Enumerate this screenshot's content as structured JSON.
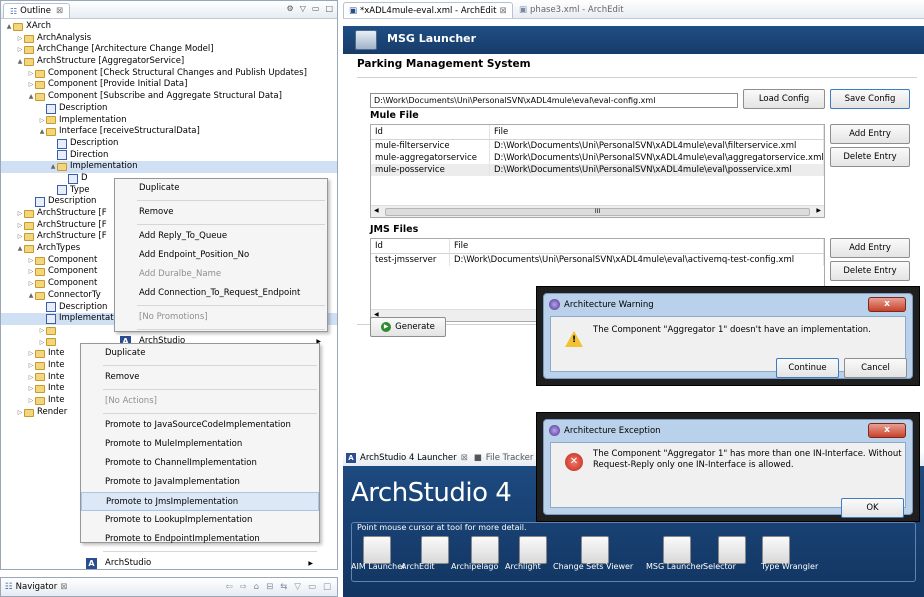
{
  "outline": {
    "tab_label": "Outline",
    "tab_close": "⊠",
    "tree": [
      {
        "text": "XArch",
        "indent": 0,
        "twisty": "▲",
        "icon": "folder"
      },
      {
        "text": "ArchAnalysis",
        "indent": 1,
        "twisty": "▷",
        "icon": "folder"
      },
      {
        "text": "ArchChange [Architecture Change Model]",
        "indent": 1,
        "twisty": "▷",
        "icon": "folder"
      },
      {
        "text": "ArchStructure [AggregatorService]",
        "indent": 1,
        "twisty": "▲",
        "icon": "folder"
      },
      {
        "text": "Component [Check Structural Changes and Publish Updates]",
        "indent": 2,
        "twisty": "▷",
        "icon": "folder"
      },
      {
        "text": "Component [Provide Initial Data]",
        "indent": 2,
        "twisty": "▷",
        "icon": "folder"
      },
      {
        "text": "Component [Subscribe and Aggregate Structural Data]",
        "indent": 2,
        "twisty": "▲",
        "icon": "folder"
      },
      {
        "text": "Description",
        "indent": 3,
        "twisty": "",
        "icon": "doc"
      },
      {
        "text": "Implementation",
        "indent": 3,
        "twisty": "▷",
        "icon": "folder"
      },
      {
        "text": "Interface [receiveStructuralData]",
        "indent": 3,
        "twisty": "▲",
        "icon": "folder"
      },
      {
        "text": "Description",
        "indent": 4,
        "twisty": "",
        "icon": "doc"
      },
      {
        "text": "Direction",
        "indent": 4,
        "twisty": "",
        "icon": "doc"
      },
      {
        "text": "Implementation",
        "indent": 4,
        "twisty": "▲",
        "icon": "folder",
        "selected": true
      },
      {
        "text": "D",
        "indent": 5,
        "twisty": "",
        "icon": "doc"
      },
      {
        "text": "Type",
        "indent": 4,
        "twisty": "",
        "icon": "doc"
      },
      {
        "text": "Description",
        "indent": 2,
        "twisty": "",
        "icon": "doc"
      },
      {
        "text": "ArchStructure [F",
        "indent": 1,
        "twisty": "▷",
        "icon": "folder"
      },
      {
        "text": "ArchStructure [F",
        "indent": 1,
        "twisty": "▷",
        "icon": "folder"
      },
      {
        "text": "ArchStructure [F",
        "indent": 1,
        "twisty": "▷",
        "icon": "folder"
      },
      {
        "text": "ArchTypes",
        "indent": 1,
        "twisty": "▲",
        "icon": "folder"
      },
      {
        "text": "Component",
        "indent": 2,
        "twisty": "▷",
        "icon": "folder"
      },
      {
        "text": "Component",
        "indent": 2,
        "twisty": "▷",
        "icon": "folder"
      },
      {
        "text": "Component",
        "indent": 2,
        "twisty": "▷",
        "icon": "folder"
      },
      {
        "text": "ConnectorTy",
        "indent": 2,
        "twisty": "▲",
        "icon": "folder"
      },
      {
        "text": "Description",
        "indent": 3,
        "twisty": "",
        "icon": "doc"
      },
      {
        "text": "Implementation",
        "indent": 3,
        "twisty": "",
        "icon": "doc",
        "selected": true
      },
      {
        "text": "",
        "indent": 3,
        "twisty": "▷",
        "icon": "folder"
      },
      {
        "text": "",
        "indent": 3,
        "twisty": "▷",
        "icon": "folder"
      },
      {
        "text": "Inte",
        "indent": 2,
        "twisty": "▷",
        "icon": "folder"
      },
      {
        "text": "Inte",
        "indent": 2,
        "twisty": "▷",
        "icon": "folder"
      },
      {
        "text": "Inte",
        "indent": 2,
        "twisty": "▷",
        "icon": "folder"
      },
      {
        "text": "Inte",
        "indent": 2,
        "twisty": "▷",
        "icon": "folder"
      },
      {
        "text": "Inte",
        "indent": 2,
        "twisty": "▷",
        "icon": "folder"
      },
      {
        "text": "Render",
        "indent": 1,
        "twisty": "▷",
        "icon": "folder"
      }
    ]
  },
  "menu1": {
    "items": [
      "Duplicate",
      "Remove",
      "Add Reply_To_Queue",
      "Add Endpoint_Position_No",
      "Add Duralbe_Name",
      "Add Connection_To_Request_Endpoint",
      "[No Promotions]",
      "ArchStudio"
    ]
  },
  "menu2": {
    "items": [
      "Duplicate",
      "Remove",
      "[No Actions]",
      "Promote to JavaSourceCodeImplementation",
      "Promote to MuleImplementation",
      "Promote to ChannelImplementation",
      "Promote to JavaImplementation",
      "Promote to JmsImplementation",
      "Promote to LookupImplementation",
      "Promote to EndpointImplementation",
      "ArchStudio"
    ]
  },
  "navigator": {
    "label": "Navigator"
  },
  "editor": {
    "tab1": "*xADL4mule-eval.xml - ArchEdit",
    "tab2": "phase3.xml - ArchEdit",
    "banner": "MSG Launcher",
    "title": "Parking Management System",
    "config_path": "D:\\Work\\Documents\\Uni\\PersonalSVN\\xADL4mule\\eval\\eval-config.xml",
    "load_config": "Load Config",
    "save_config": "Save Config",
    "mule_files_label": "Mule File",
    "col_id": "Id",
    "col_file": "File",
    "mule_rows": [
      {
        "id": "mule-filterservice",
        "file": "D:\\Work\\Documents\\Uni\\PersonalSVN\\xADL4mule\\eval\\filterservice.xml"
      },
      {
        "id": "mule-aggregatorservice",
        "file": "D:\\Work\\Documents\\Uni\\PersonalSVN\\xADL4mule\\eval\\aggregatorservice.xml"
      },
      {
        "id": "mule-posservice",
        "file": "D:\\Work\\Documents\\Uni\\PersonalSVN\\xADL4mule\\eval\\posservice.xml"
      }
    ],
    "add_entry": "Add Entry",
    "delete_entry": "Delete Entry",
    "jms_files_label": "JMS Files",
    "jms_rows": [
      {
        "id": "test-jmsserver",
        "file": "D:\\Work\\Documents\\Uni\\PersonalSVN\\xADL4mule\\eval\\activemq-test-config.xml"
      }
    ],
    "scroll_mark": "III",
    "generate": "Generate"
  },
  "warning": {
    "title": "Architecture Warning",
    "message": "The Component \"Aggregator 1\" doesn't have an implementation.",
    "continue": "Continue",
    "cancel": "Cancel"
  },
  "exception": {
    "title": "Architecture Exception",
    "message_line1": "The Component \"Aggregator 1\" has more than one IN-Interface. Without",
    "message_line2": "Request-Reply only one IN-Interface is allowed.",
    "ok": "OK"
  },
  "launcher": {
    "tab1": "ArchStudio 4 Launcher",
    "tab2": "File Tracker View",
    "heading": "ArchStudio 4",
    "hint": "Point mouse cursor at tool for more detail.",
    "tools": [
      "AIM Launcher",
      "ArchEdit",
      "Archipelago",
      "Archlight",
      "Change Sets Viewer",
      "MSG Launcher",
      "Selector",
      "Type Wrangler"
    ]
  },
  "colors": {
    "banner": "#1f4f85",
    "launcher": "#123561",
    "selection": "#cfe0f5"
  }
}
